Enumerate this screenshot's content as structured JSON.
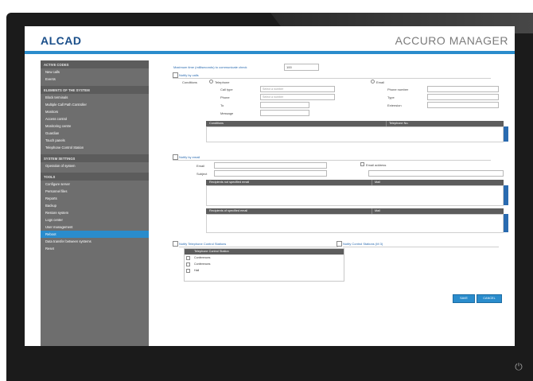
{
  "brand": {
    "logo": "ALCAD",
    "app_title": "ACCURO MANAGER"
  },
  "colors": {
    "accent": "#2a8ccc",
    "sidebar": "#6e6e6e",
    "table_header": "#5d5d5d"
  },
  "icons": {
    "power": "power-icon"
  },
  "sidebar": {
    "sections": [
      {
        "title": "ACTIVE CODES",
        "items": [
          "New calls",
          "Events"
        ]
      },
      {
        "title": "ELEMENTS OF THE SYSTEM",
        "items": [
          "Block terminals",
          "Multiple Call Path Controller",
          "Monitors",
          "Access control",
          "Monitoring centre",
          "Guardian",
          "Touch panels",
          "Telephone Control Station"
        ]
      },
      {
        "title": "SYSTEM SETTINGS",
        "items": [
          "Operation of system"
        ]
      },
      {
        "title": "TOOLS",
        "items": [
          "Configure server",
          "Personnel files",
          "Reports",
          "Backup",
          "Restore system",
          "Logs center",
          "User management",
          "Reboot",
          "Data transfer between systems",
          "Reset"
        ]
      }
    ],
    "active_item": "Reboot"
  },
  "form": {
    "timeout_label": "Maximum time (milliseconds) to communicate check",
    "timeout_value": "100",
    "notify_label": "Notify by calls",
    "type_label": "Conditions",
    "radio1": "Telephone",
    "radio2": "Email",
    "fields_left": [
      "Call type",
      "Phone",
      "To",
      "Message"
    ],
    "fields_right": [
      "Phone number",
      "Type",
      "Extension"
    ],
    "select1": "Select a number",
    "select2": "Select a number",
    "table1_cols": [
      "Conditions",
      "Telephone No."
    ],
    "notify_email_label": "Notify by email",
    "email_fields": [
      "Email",
      "Subject"
    ],
    "email_right_fields": [
      "Email address"
    ],
    "table2_header": "Recipients not specified email",
    "table2_col2": "Mail",
    "table3_header": "Recipients of specified email",
    "table3_col2": "Mail",
    "station_label": "Notify Telephone Control Stations",
    "station_list_header": "Telephone Control Station",
    "station_list": [
      "Conferences",
      "Conferences",
      "Hall"
    ],
    "station_right_label": "Notify Control Stations (M 3)",
    "save_button": "SAVE",
    "cancel_button": "CANCEL"
  }
}
